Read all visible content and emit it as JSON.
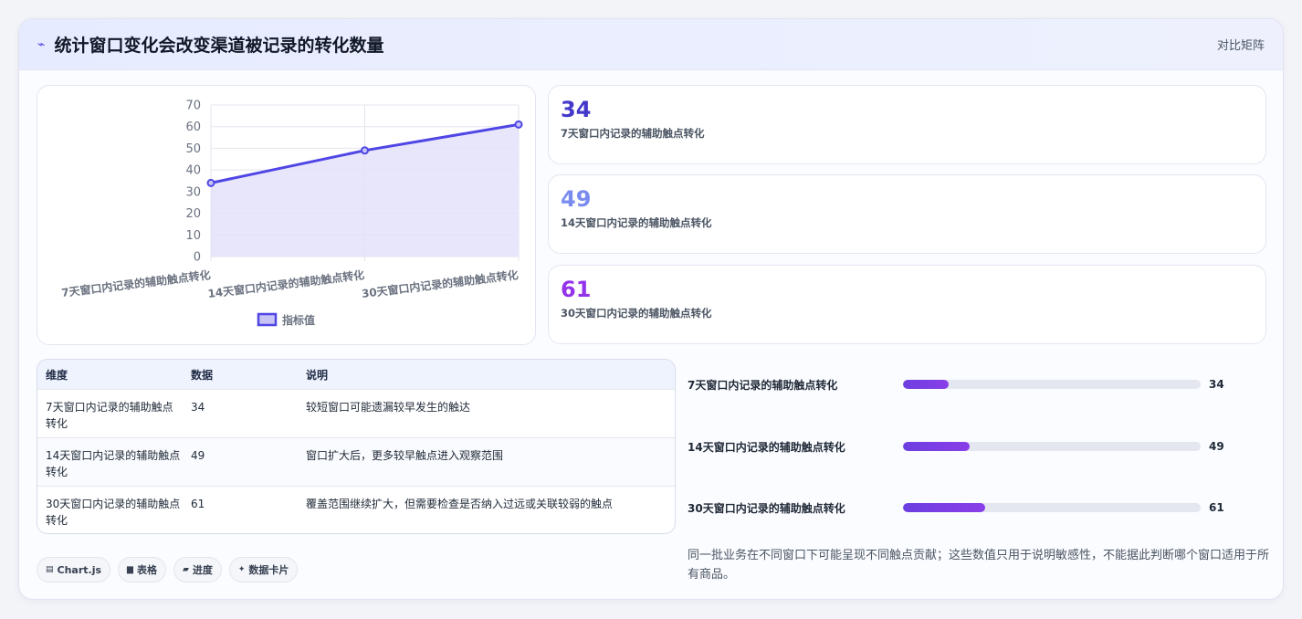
{
  "header": {
    "icon": "pulse-icon",
    "title": "统计窗口变化会改变渠道被记录的转化数量",
    "right_label": "对比矩阵"
  },
  "colors": {
    "line": "#4f46e5",
    "area": "#e4e2fa",
    "kpi1": "#4338ca",
    "kpi2": "#7b8cf0",
    "kpi3": "#9333ea",
    "bar_fill_from": "#6d3fe0",
    "bar_fill_to": "#8a3ee8"
  },
  "chart_data": {
    "type": "line",
    "categories": [
      "7天窗口内记录的辅助触点转化",
      "14天窗口内记录的辅助触点转化",
      "30天窗口内记录的辅助触点转化"
    ],
    "series": [
      {
        "name": "指标值",
        "values": [
          34,
          49,
          61
        ]
      }
    ],
    "ylim": [
      0,
      70
    ],
    "yticks": [
      0,
      10,
      20,
      30,
      40,
      50,
      60,
      70
    ],
    "grid": true,
    "legend": "bottom"
  },
  "kpis": [
    {
      "value": "34",
      "label": "7天窗口内记录的辅助触点转化"
    },
    {
      "value": "49",
      "label": "14天窗口内记录的辅助触点转化"
    },
    {
      "value": "61",
      "label": "30天窗口内记录的辅助触点转化"
    }
  ],
  "table": {
    "headers": [
      "维度",
      "数据",
      "说明"
    ],
    "rows": [
      [
        "7天窗口内记录的辅助触点转化",
        "34",
        "较短窗口可能遗漏较早发生的触达"
      ],
      [
        "14天窗口内记录的辅助触点转化",
        "49",
        "窗口扩大后，更多较早触点进入观察范围"
      ],
      [
        "30天窗口内记录的辅助触点转化",
        "61",
        "覆盖范围继续扩大，但需要检查是否纳入过远或关联较弱的触点"
      ]
    ]
  },
  "progress": {
    "max": 220,
    "items": [
      {
        "label": "7天窗口内记录的辅助触点转化",
        "value": 34
      },
      {
        "label": "14天窗口内记录的辅助触点转化",
        "value": 49
      },
      {
        "label": "30天窗口内记录的辅助触点转化",
        "value": 61
      }
    ]
  },
  "note": "同一批业务在不同窗口下可能呈现不同触点贡献；这些数值只用于说明敏感性，不能据此判断哪个窗口适用于所有商品。",
  "tags": [
    {
      "icon": "chart-icon",
      "label": "Chart.js"
    },
    {
      "icon": "table-icon",
      "label": "表格"
    },
    {
      "icon": "progress-icon",
      "label": "进度"
    },
    {
      "icon": "sparkle-icon",
      "label": "数据卡片"
    }
  ]
}
